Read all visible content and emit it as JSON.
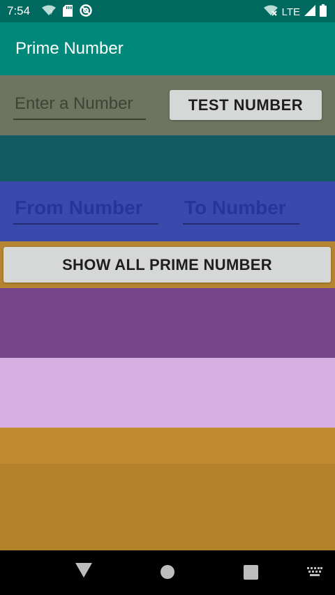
{
  "status_bar": {
    "time": "7:54",
    "network": "LTE",
    "icons": [
      "wifi-question-icon",
      "sd-card-icon",
      "at-icon",
      "wifi-off-icon",
      "signal-icon",
      "battery-icon"
    ]
  },
  "app_bar": {
    "title": "Prime Number"
  },
  "single_test": {
    "input_placeholder": "Enter a Number",
    "button_label": "TEST NUMBER"
  },
  "range_test": {
    "from_placeholder": "From Number",
    "to_placeholder": "To Number",
    "button_label": "SHOW ALL PRIME NUMBER"
  },
  "nav_bar": {
    "icons": [
      "back-icon",
      "home-icon",
      "recents-icon",
      "keyboard-icon"
    ]
  },
  "colors": {
    "status_bar": "#00695f",
    "app_bar": "#00887a",
    "row1": "#6e7460",
    "row2": "#125b63",
    "row3": "#3a4aac",
    "row4": "#b58532",
    "row5": "#77458a",
    "row6": "#d6b0e3",
    "row7": "#c28b2f",
    "row8": "#b5822c"
  }
}
